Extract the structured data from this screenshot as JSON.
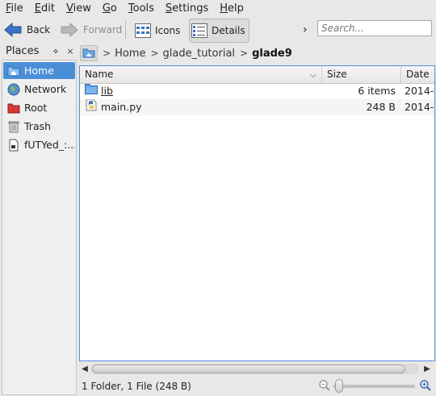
{
  "menu": [
    {
      "mnemonic": "F",
      "rest": "ile"
    },
    {
      "mnemonic": "E",
      "rest": "dit"
    },
    {
      "mnemonic": "V",
      "rest": "iew"
    },
    {
      "mnemonic": "G",
      "rest": "o"
    },
    {
      "mnemonic": "T",
      "rest": "ools"
    },
    {
      "mnemonic": "S",
      "rest": "ettings"
    },
    {
      "mnemonic": "H",
      "rest": "elp"
    }
  ],
  "toolbar": {
    "back_label": "Back",
    "forward_label": "Forward",
    "icons_label": "Icons",
    "details_label": "Details",
    "overflow_label": "›",
    "active_view": "details"
  },
  "search": {
    "placeholder": "Search...",
    "value": ""
  },
  "places": {
    "title": "Places",
    "items": [
      {
        "label": "Home",
        "icon": "home-folder-icon",
        "selected": true
      },
      {
        "label": "Network",
        "icon": "globe-icon",
        "selected": false
      },
      {
        "label": "Root",
        "icon": "red-folder-icon",
        "selected": false
      },
      {
        "label": "Trash",
        "icon": "trash-icon",
        "selected": false
      },
      {
        "label": "fUTYed_:...",
        "icon": "file-icon",
        "selected": false
      }
    ]
  },
  "breadcrumb": {
    "separator": ">",
    "items": [
      "Home",
      "glade_tutorial"
    ],
    "current": "glade9"
  },
  "columns": {
    "name": "Name",
    "size": "Size",
    "date": "Date"
  },
  "files": [
    {
      "name": "lib",
      "size": "6 items",
      "date": "2014-",
      "type": "folder",
      "icon": "folder-icon"
    },
    {
      "name": "main.py",
      "size": "248 B",
      "date": "2014-",
      "type": "file",
      "icon": "python-file-icon"
    }
  ],
  "status": {
    "text": "1 Folder, 1 File (248 B)"
  },
  "colors": {
    "accent": "#4b8ed8",
    "folder": "#5ea2e6"
  }
}
